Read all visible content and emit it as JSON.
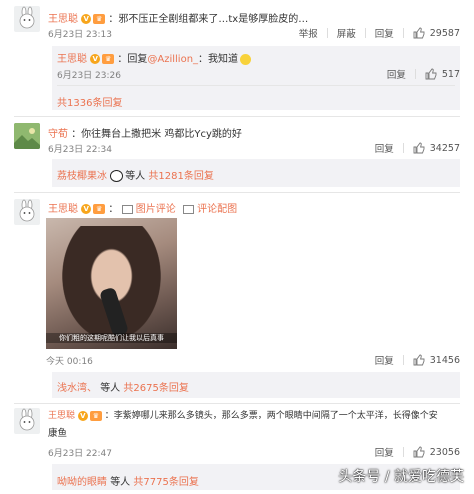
{
  "comments": [
    {
      "name": "王思聪",
      "text": "：邪不压正全剧组都来了…tx是够厚脸皮的…",
      "time": "6月23日 23:13",
      "report": "举报",
      "block": "屏蔽",
      "reply": "回复",
      "likes": "29587",
      "sub_reply": {
        "name": "王思聪",
        "text_pre": "：回复",
        "mention": "@Azillion_",
        "text_post": "：我知道",
        "time": "6月23日 23:26",
        "reply": "回复",
        "likes": "517"
      },
      "more_replies": "共1336条回复"
    },
    {
      "name": "守荀",
      "text": "：你往舞台上撒把米 鸡都比Ycy跳的好",
      "time": "6月23日 22:34",
      "reply": "回复",
      "likes": "34257",
      "reply_user": "荔枝椰果冰",
      "reply_etc": "等人",
      "reply_count": "共1281条回复"
    },
    {
      "name": "王思聪",
      "text": "：",
      "img_comment": "图片评论",
      "view_img": "评论配图",
      "caption": "你们粗的这期呢酷们让我以后真事",
      "time": "今天 00:16",
      "reply": "回复",
      "likes": "31456",
      "reply_user": "浅水湾、",
      "reply_etc": "等人",
      "reply_count": "共2675条回复"
    },
    {
      "name": "王思聪",
      "text": "：李紫婷哪儿来那么多镜头，那么多票，两个眼睛中间隔了一个太平洋，长得像个安",
      "text2": "康鱼",
      "time": "6月23日 22:47",
      "reply": "回复",
      "likes": "23056",
      "reply_user": "呦呦的眼睛",
      "reply_etc": "等人",
      "reply_count": "共7775条回复"
    }
  ],
  "watermark": "头条号 / 就爱吃德芙",
  "colors": {
    "name": "#eb7350",
    "link": "#eb7350",
    "reply_bg": "#f2f2f5"
  }
}
